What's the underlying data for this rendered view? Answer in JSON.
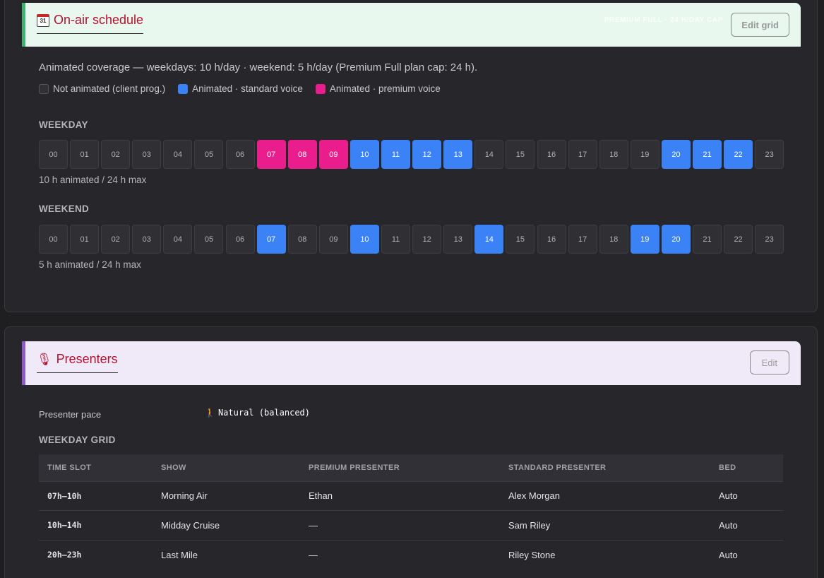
{
  "schedule": {
    "title": "On-air schedule",
    "icon": "calendar-icon",
    "icon_text": "31",
    "cap_badge": "PREMIUM FULL · 24 H/DAY CAP",
    "edit_label": "Edit grid",
    "coverage_text": "Animated coverage — weekdays: 10 h/day · weekend: 5 h/day (Premium Full plan cap: 24 h).",
    "legend": {
      "off": "Not animated (client prog.)",
      "standard": "Animated · standard voice",
      "premium": "Animated · premium voice"
    },
    "colors": {
      "standard": "#3b82f6",
      "premium": "#e91e8c",
      "off": "#2f2f34"
    },
    "weekday": {
      "label": "WEEKDAY",
      "summary": "10 h animated / 24 h max",
      "hours": [
        {
          "h": "00",
          "s": "off"
        },
        {
          "h": "01",
          "s": "off"
        },
        {
          "h": "02",
          "s": "off"
        },
        {
          "h": "03",
          "s": "off"
        },
        {
          "h": "04",
          "s": "off"
        },
        {
          "h": "05",
          "s": "off"
        },
        {
          "h": "06",
          "s": "off"
        },
        {
          "h": "07",
          "s": "prem"
        },
        {
          "h": "08",
          "s": "prem"
        },
        {
          "h": "09",
          "s": "prem"
        },
        {
          "h": "10",
          "s": "std"
        },
        {
          "h": "11",
          "s": "std"
        },
        {
          "h": "12",
          "s": "std"
        },
        {
          "h": "13",
          "s": "std"
        },
        {
          "h": "14",
          "s": "off"
        },
        {
          "h": "15",
          "s": "off"
        },
        {
          "h": "16",
          "s": "off"
        },
        {
          "h": "17",
          "s": "off"
        },
        {
          "h": "18",
          "s": "off"
        },
        {
          "h": "19",
          "s": "off"
        },
        {
          "h": "20",
          "s": "std"
        },
        {
          "h": "21",
          "s": "std"
        },
        {
          "h": "22",
          "s": "std"
        },
        {
          "h": "23",
          "s": "off"
        }
      ]
    },
    "weekend": {
      "label": "WEEKEND",
      "summary": "5 h animated / 24 h max",
      "hours": [
        {
          "h": "00",
          "s": "off"
        },
        {
          "h": "01",
          "s": "off"
        },
        {
          "h": "02",
          "s": "off"
        },
        {
          "h": "03",
          "s": "off"
        },
        {
          "h": "04",
          "s": "off"
        },
        {
          "h": "05",
          "s": "off"
        },
        {
          "h": "06",
          "s": "off"
        },
        {
          "h": "07",
          "s": "std"
        },
        {
          "h": "08",
          "s": "off"
        },
        {
          "h": "09",
          "s": "off"
        },
        {
          "h": "10",
          "s": "std"
        },
        {
          "h": "11",
          "s": "off"
        },
        {
          "h": "12",
          "s": "off"
        },
        {
          "h": "13",
          "s": "off"
        },
        {
          "h": "14",
          "s": "std"
        },
        {
          "h": "15",
          "s": "off"
        },
        {
          "h": "16",
          "s": "off"
        },
        {
          "h": "17",
          "s": "off"
        },
        {
          "h": "18",
          "s": "off"
        },
        {
          "h": "19",
          "s": "std"
        },
        {
          "h": "20",
          "s": "std"
        },
        {
          "h": "21",
          "s": "off"
        },
        {
          "h": "22",
          "s": "off"
        },
        {
          "h": "23",
          "s": "off"
        }
      ]
    }
  },
  "presenters": {
    "title": "Presenters",
    "icon": "microphone-icon",
    "icon_glyph": "🎙",
    "edit_label": "Edit",
    "pace_label": "Presenter pace",
    "pace_icon": "walking-person-icon",
    "pace_icon_glyph": "🚶",
    "pace_value": "Natural (balanced)",
    "grid_label": "WEEKDAY GRID",
    "columns": [
      "TIME SLOT",
      "SHOW",
      "PREMIUM PRESENTER",
      "STANDARD PRESENTER",
      "BED"
    ],
    "rows": [
      {
        "slot": "07h–10h",
        "show": "Morning Air",
        "premium": "Ethan",
        "standard": "Alex Morgan",
        "bed": "Auto"
      },
      {
        "slot": "10h–14h",
        "show": "Midday Cruise",
        "premium": "—",
        "standard": "Sam Riley",
        "bed": "Auto"
      },
      {
        "slot": "20h–23h",
        "show": "Last Mile",
        "premium": "—",
        "standard": "Riley Stone",
        "bed": "Auto"
      }
    ]
  }
}
